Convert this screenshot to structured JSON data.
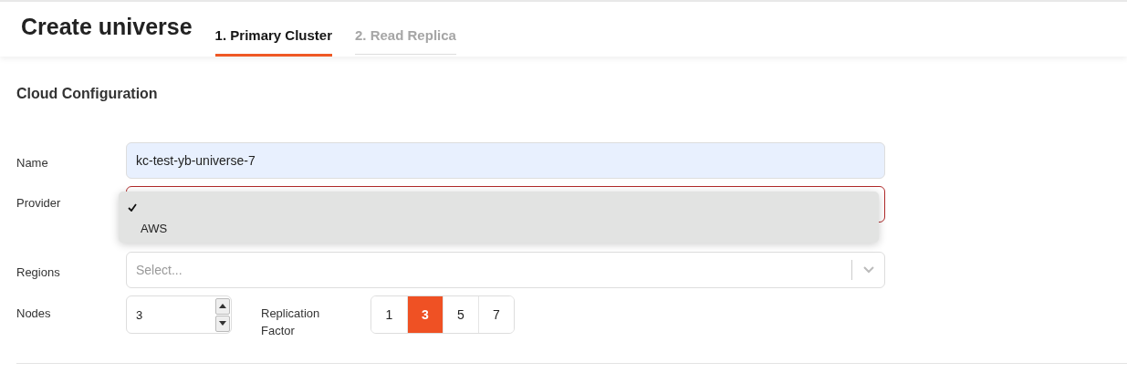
{
  "header": {
    "title": "Create universe"
  },
  "tabs": [
    {
      "label": "1. Primary Cluster",
      "selected": true
    },
    {
      "label": "2. Read Replica",
      "selected": false
    }
  ],
  "section": {
    "title": "Cloud Configuration"
  },
  "name_field": {
    "label": "Name",
    "value": "kc-test-yb-universe-7"
  },
  "provider_field": {
    "label": "Provider",
    "invalid": true,
    "options": [
      {
        "selected": true
      },
      {
        "label": "AWS",
        "selected": false
      }
    ]
  },
  "regions_field": {
    "label": "Regions",
    "placeholder": "Select..."
  },
  "nodes_field": {
    "label": "Nodes",
    "value": "3"
  },
  "replication_factor": {
    "label": "Replication Factor",
    "options": [
      {
        "label": "1",
        "selected": false
      },
      {
        "label": "3",
        "selected": true
      },
      {
        "label": "5",
        "selected": false
      },
      {
        "label": "7",
        "selected": false
      }
    ]
  }
}
